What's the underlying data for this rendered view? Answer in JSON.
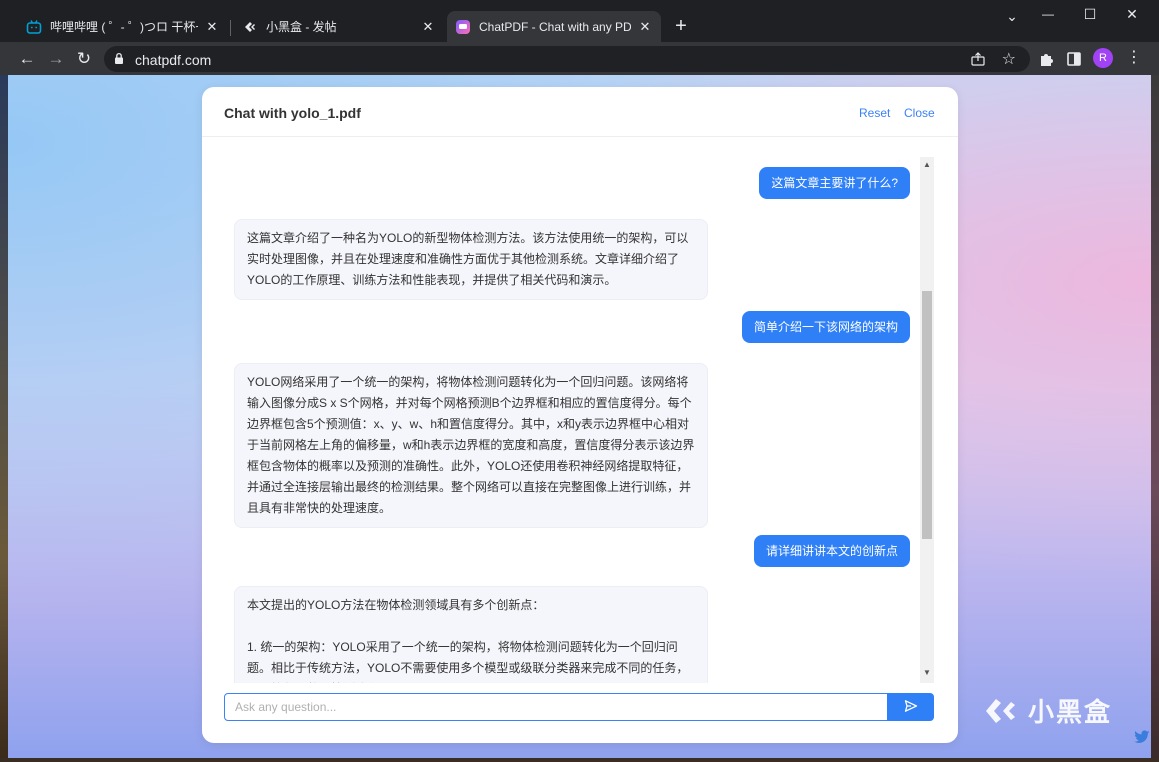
{
  "browser": {
    "tabs": [
      {
        "title": "哔哩哔哩 ( ゜- ゜)つロ 干杯~-bilibili",
        "active": false,
        "icon": "bilibili-icon"
      },
      {
        "title": "小黑盒 - 发帖",
        "active": false,
        "icon": "heybox-icon"
      },
      {
        "title": "ChatPDF - Chat with any PDF!",
        "active": true,
        "icon": "chatpdf-icon"
      }
    ],
    "url": "chatpdf.com",
    "profile_initial": "R",
    "window_controls": {
      "minimize": "—",
      "maximize": "☐",
      "close": "✕"
    }
  },
  "card": {
    "title": "Chat with yolo_1.pdf",
    "reset_label": "Reset",
    "close_label": "Close"
  },
  "messages": [
    {
      "role": "user",
      "text": "这篇文章主要讲了什么?"
    },
    {
      "role": "assistant",
      "text": "这篇文章介绍了一种名为YOLO的新型物体检测方法。该方法使用统一的架构，可以实时处理图像，并且在处理速度和准确性方面优于其他检测系统。文章详细介绍了YOLO的工作原理、训练方法和性能表现，并提供了相关代码和演示。"
    },
    {
      "role": "user",
      "text": "简单介绍一下该网络的架构"
    },
    {
      "role": "assistant",
      "text": "YOLO网络采用了一个统一的架构，将物体检测问题转化为一个回归问题。该网络将输入图像分成S x S个网格，并对每个网格预测B个边界框和相应的置信度得分。每个边界框包含5个预测值：x、y、w、h和置信度得分。其中，x和y表示边界框中心相对于当前网格左上角的偏移量，w和h表示边界框的宽度和高度，置信度得分表示该边界框包含物体的概率以及预测的准确性。此外，YOLO还使用卷积神经网络提取特征，并通过全连接层输出最终的检测结果。整个网络可以直接在完整图像上进行训练，并且具有非常快的处理速度。"
    },
    {
      "role": "user",
      "text": "请详细讲讲本文的创新点"
    },
    {
      "role": "assistant",
      "text": "本文提出的YOLO方法在物体检测领域具有多个创新点：\n\n1. 统一的架构：YOLO采用了一个统一的架构，将物体检测问题转化为一个回归问题。相比于传统方法，YOLO不需要使用多个模型或级联分类器来完成不同的任务，从而简化了整个检测流程。"
    }
  ],
  "composer": {
    "placeholder": "Ask any question..."
  },
  "watermark": {
    "text": "小黑盒"
  },
  "colors": {
    "accent": "#2f7ff7",
    "bot_bubble": "#f5f6fb"
  }
}
